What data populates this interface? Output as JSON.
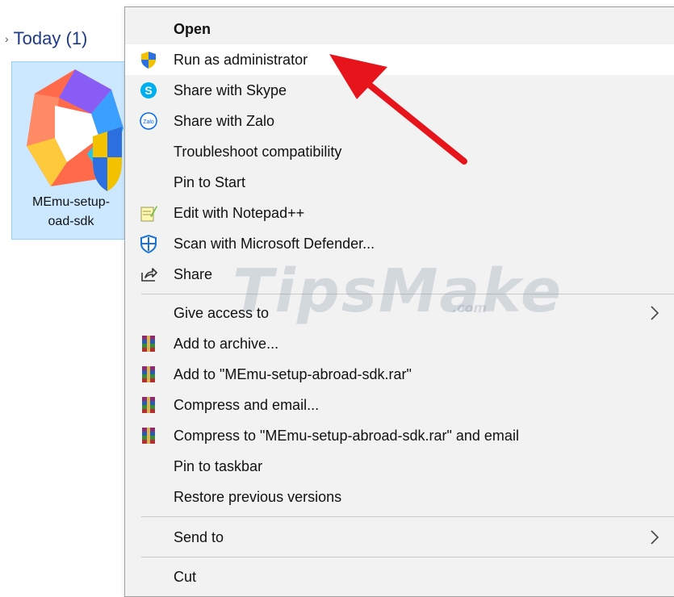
{
  "explorer": {
    "group_label": "Today (1)",
    "file": {
      "name_line1": "MEmu-setup-",
      "name_line2": "oad-sdk"
    }
  },
  "menu": {
    "items": [
      {
        "label": "Open",
        "bold": true,
        "icon": ""
      },
      {
        "label": "Run as administrator",
        "icon": "shield-icon",
        "highlighted": true
      },
      {
        "label": "Share with Skype",
        "icon": "skype-icon"
      },
      {
        "label": "Share with Zalo",
        "icon": "zalo-icon"
      },
      {
        "label": "Troubleshoot compatibility",
        "icon": ""
      },
      {
        "label": "Pin to Start",
        "icon": ""
      },
      {
        "label": "Edit with Notepad++",
        "icon": "notepad-plus-plus-icon"
      },
      {
        "label": "Scan with Microsoft Defender...",
        "icon": "defender-icon"
      },
      {
        "label": "Share",
        "icon": "share-icon"
      },
      {
        "label": "Give access to",
        "icon": "",
        "submenu": true
      },
      {
        "label": "Add to archive...",
        "icon": "winrar-icon"
      },
      {
        "label": "Add to \"MEmu-setup-abroad-sdk.rar\"",
        "icon": "winrar-icon"
      },
      {
        "label": "Compress and email...",
        "icon": "winrar-icon"
      },
      {
        "label": "Compress to \"MEmu-setup-abroad-sdk.rar\" and email",
        "icon": "winrar-icon"
      },
      {
        "label": "Pin to taskbar",
        "icon": ""
      },
      {
        "label": "Restore previous versions",
        "icon": ""
      },
      {
        "label": "Send to",
        "icon": "",
        "submenu": true
      },
      {
        "label": "Cut",
        "icon": ""
      }
    ]
  },
  "watermark": {
    "main": "TipsMake",
    "sub": ".com"
  },
  "colors": {
    "annotation_arrow": "#e8141b",
    "selection": "#cce8ff"
  }
}
